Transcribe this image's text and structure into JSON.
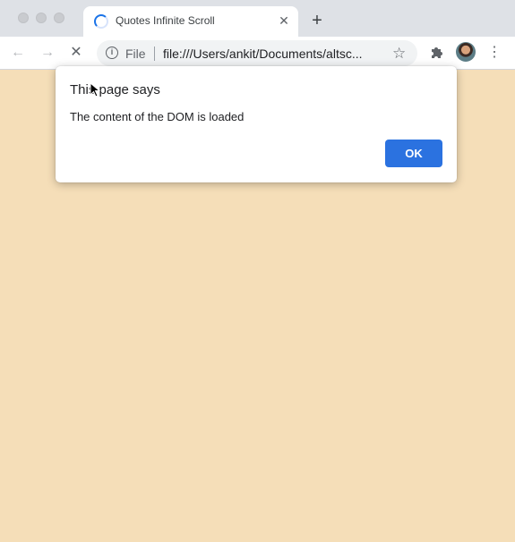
{
  "browser": {
    "tab": {
      "title": "Quotes Infinite Scroll",
      "close_symbol": "✕"
    },
    "new_tab_symbol": "+",
    "toolbar": {
      "back_icon": "←",
      "forward_icon": "→",
      "stop_icon": "✕",
      "scheme_label": "File",
      "url": "file:///Users/ankit/Documents/altsc...",
      "star_icon": "☆",
      "menu_icon": "⋮"
    }
  },
  "dialog": {
    "title": "This page says",
    "message": "The content of the DOM is loaded",
    "ok_label": "OK"
  },
  "colors": {
    "page_background": "#f5deb8",
    "ok_button": "#2b72e0",
    "tab_strip": "#dee1e6"
  }
}
